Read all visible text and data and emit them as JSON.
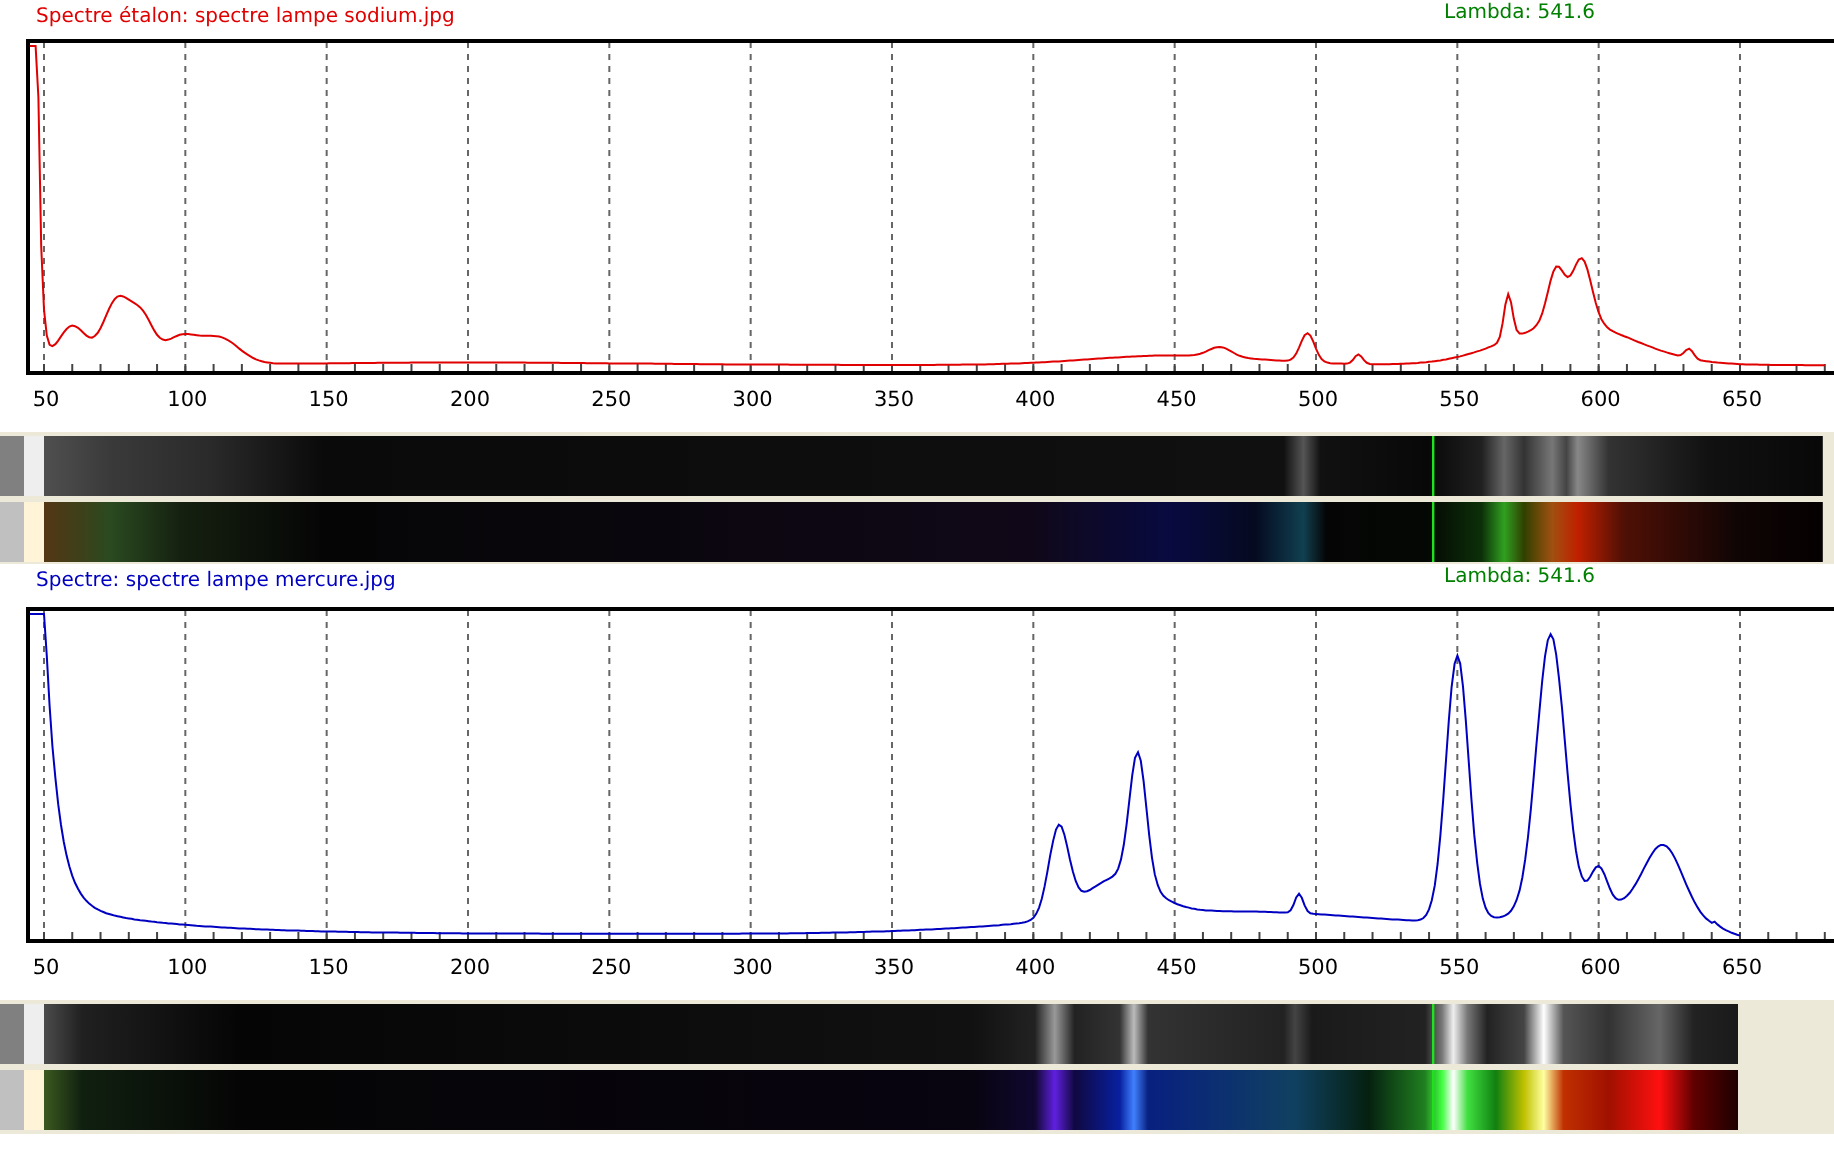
{
  "panels": [
    {
      "kind": "sodium",
      "title": "Spectre étalon: spectre lampe sodium.jpg",
      "color": "#e00000",
      "lambda": "Lambda: 541.6",
      "ticks": [
        "50",
        "100",
        "150",
        "200",
        "250",
        "300",
        "350",
        "400",
        "450",
        "500",
        "550",
        "600",
        "650"
      ]
    },
    {
      "kind": "mercury",
      "title": "Spectre: spectre lampe mercure.jpg",
      "color": "#0000c0",
      "lambda": "Lambda: 541.6",
      "ticks": [
        "50",
        "100",
        "150",
        "200",
        "250",
        "300",
        "350",
        "400",
        "450",
        "500",
        "550",
        "600",
        "650"
      ]
    }
  ]
}
